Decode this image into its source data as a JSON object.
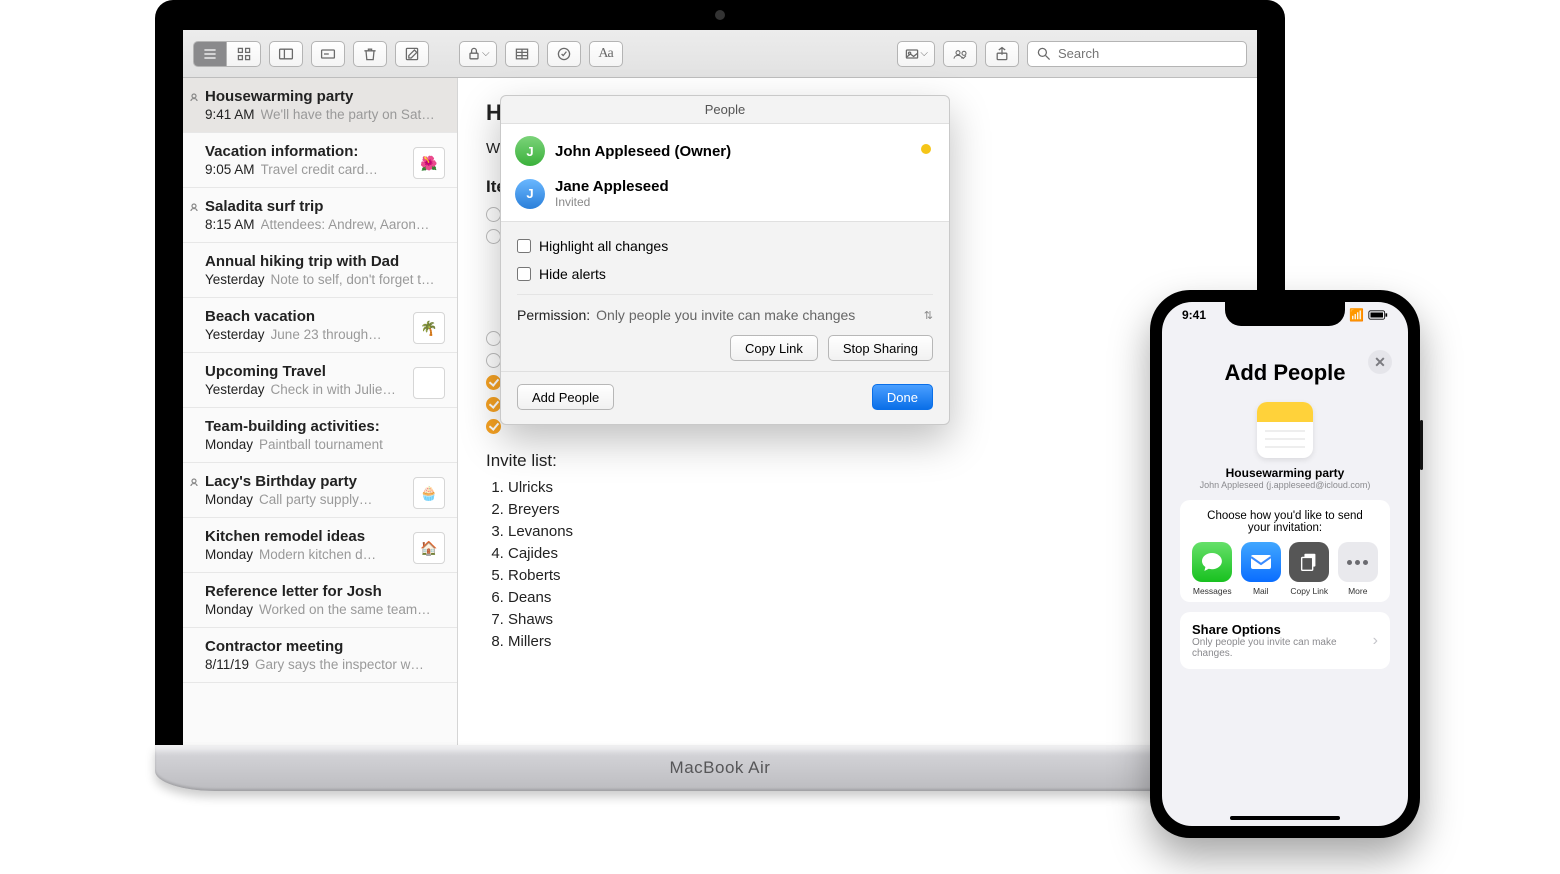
{
  "mac": {
    "label": "MacBook Air",
    "toolbar": {
      "search_placeholder": "Search"
    },
    "notes": [
      {
        "title": "Housewarming party",
        "time": "9:41 AM",
        "snippet": "We'll have the party on Sat…",
        "shared": true,
        "selected": true
      },
      {
        "title": "Vacation information:",
        "time": "9:05 AM",
        "snippet": "Travel credit card…",
        "thumb": "🌺"
      },
      {
        "title": "Saladita surf trip",
        "time": "8:15 AM",
        "snippet": "Attendees: Andrew, Aaron…",
        "shared": true
      },
      {
        "title": "Annual hiking trip with Dad",
        "time": "Yesterday",
        "snippet": "Note to self, don't forget t…"
      },
      {
        "title": "Beach vacation",
        "time": "Yesterday",
        "snippet": "June 23 through…",
        "thumb": "🌴"
      },
      {
        "title": "Upcoming Travel",
        "time": "Yesterday",
        "snippet": "Check in with Julie…",
        "thumb": " "
      },
      {
        "title": "Team-building activities:",
        "time": "Monday",
        "snippet": "Paintball tournament"
      },
      {
        "title": "Lacy's Birthday party",
        "time": "Monday",
        "snippet": "Call party supply…",
        "shared": true,
        "thumb": "🧁"
      },
      {
        "title": "Kitchen remodel ideas",
        "time": "Monday",
        "snippet": "Modern kitchen d…",
        "thumb": "🏠"
      },
      {
        "title": "Reference letter for Josh",
        "time": "Monday",
        "snippet": "Worked on the same team…"
      },
      {
        "title": "Contractor meeting",
        "time": "8/11/19",
        "snippet": "Gary says the inspector w…"
      }
    ],
    "content": {
      "heading": "Ho",
      "para": "We",
      "items_label": "Ite",
      "invite_label": "Invite list:",
      "invitees": [
        "Ulricks",
        "Breyers",
        "Levanons",
        "Cajides",
        "Roberts",
        "Deans",
        "Shaws",
        "Millers"
      ]
    },
    "popover": {
      "title": "People",
      "people": [
        {
          "name": "John Appleseed (Owner)",
          "status": "",
          "presence": true,
          "avatar": "green",
          "initial": "J"
        },
        {
          "name": "Jane Appleseed",
          "status": "Invited",
          "avatar": "blue",
          "initial": "J"
        }
      ],
      "highlight_label": "Highlight all changes",
      "hide_label": "Hide alerts",
      "permission_label": "Permission:",
      "permission_value": "Only people you invite can make changes",
      "copy_link": "Copy Link",
      "stop_sharing": "Stop Sharing",
      "add_people": "Add People",
      "done": "Done"
    }
  },
  "iphone": {
    "time": "9:41",
    "title": "Add People",
    "note_name": "Housewarming party",
    "note_owner": "John Appleseed (j.appleseed@icloud.com)",
    "hint": "Choose how you'd like to send your invitation:",
    "apps": [
      {
        "label": "Messages"
      },
      {
        "label": "Mail"
      },
      {
        "label": "Copy Link"
      },
      {
        "label": "More"
      }
    ],
    "share_title": "Share Options",
    "share_sub": "Only people you invite can make changes."
  }
}
